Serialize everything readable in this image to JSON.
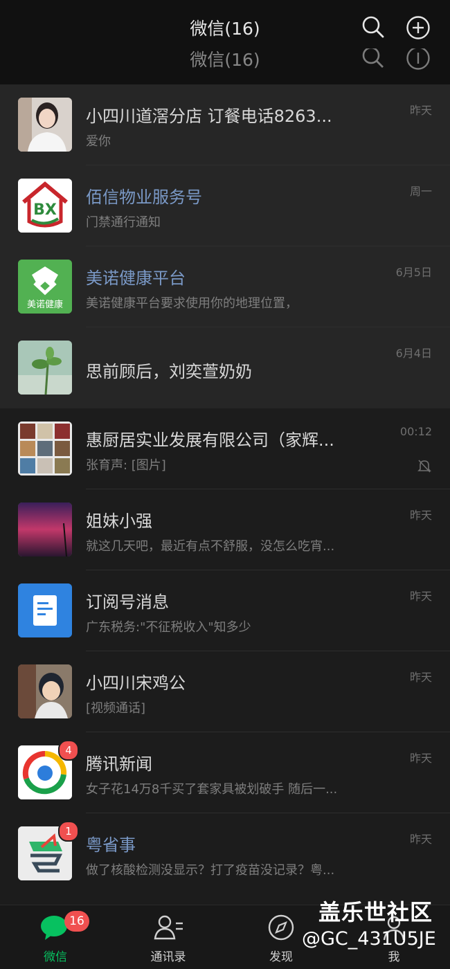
{
  "header": {
    "title": "微信(16)",
    "title_ghost": "微信(16)",
    "search_icon": "search-icon",
    "add_icon": "plus-circle-icon"
  },
  "chats": [
    {
      "name": "小四川道滘分店  订餐电话8263...",
      "preview": "爱你",
      "time": "昨天",
      "blue": false,
      "pinned": true,
      "avatar": "woman-photo"
    },
    {
      "name": "佰信物业服务号",
      "preview": "门禁通行通知",
      "time": "周一",
      "blue": true,
      "pinned": true,
      "avatar": "bx-house-logo"
    },
    {
      "name": "美诺健康平台",
      "preview": "美诺健康平台要求使用你的地理位置，",
      "time": "6月5日",
      "blue": true,
      "pinned": true,
      "avatar": "meinuo-logo",
      "avatar_text": "美诺健康"
    },
    {
      "name": "思前顾后，刘奕萱奶奶",
      "preview": "",
      "time": "6月4日",
      "blue": false,
      "pinned": true,
      "avatar": "plant-photo"
    },
    {
      "name": "惠厨居实业发展有限公司（家辉...",
      "preview": "张育声: [图片]",
      "time": "00:12",
      "blue": false,
      "pinned": false,
      "avatar": "group-grid",
      "muted": true
    },
    {
      "name": "姐妹小强",
      "preview": "就这几天吧，最近有点不舒服，没怎么吃宵...",
      "time": "昨天",
      "blue": false,
      "pinned": false,
      "avatar": "sky-photo"
    },
    {
      "name": "订阅号消息",
      "preview": "广东税务:\"不征税收入\"知多少",
      "time": "昨天",
      "blue": false,
      "pinned": false,
      "avatar": "subscription-icon"
    },
    {
      "name": "小四川宋鸡公",
      "preview": "[视频通话]",
      "time": "昨天",
      "blue": false,
      "pinned": false,
      "avatar": "cartoon-photo"
    },
    {
      "name": "腾讯新闻",
      "preview": "女子花14万8千买了套家具被划破手 随后一...",
      "time": "昨天",
      "blue": false,
      "pinned": false,
      "avatar": "tencent-news-logo",
      "badge": "4"
    },
    {
      "name": "粤省事",
      "preview": "做了核酸检测没显示？打了疫苗没记录？粤...",
      "time": "昨天",
      "blue": true,
      "pinned": false,
      "avatar": "yueshengshi-logo",
      "badge": "1"
    }
  ],
  "tabs": [
    {
      "label": "微信",
      "icon": "chat-bubble-icon",
      "badge": "16",
      "active": true
    },
    {
      "label": "通讯录",
      "icon": "contacts-icon",
      "active": false
    },
    {
      "label": "发现",
      "icon": "compass-icon",
      "active": false
    },
    {
      "label": "我",
      "icon": "person-icon",
      "active": false
    }
  ],
  "watermark": {
    "line1": "盖乐世社区",
    "line2": "@GC_431U5JE"
  },
  "colors": {
    "accent": "#07c160",
    "badge": "#f05050",
    "link_blue": "#7a99c7"
  }
}
